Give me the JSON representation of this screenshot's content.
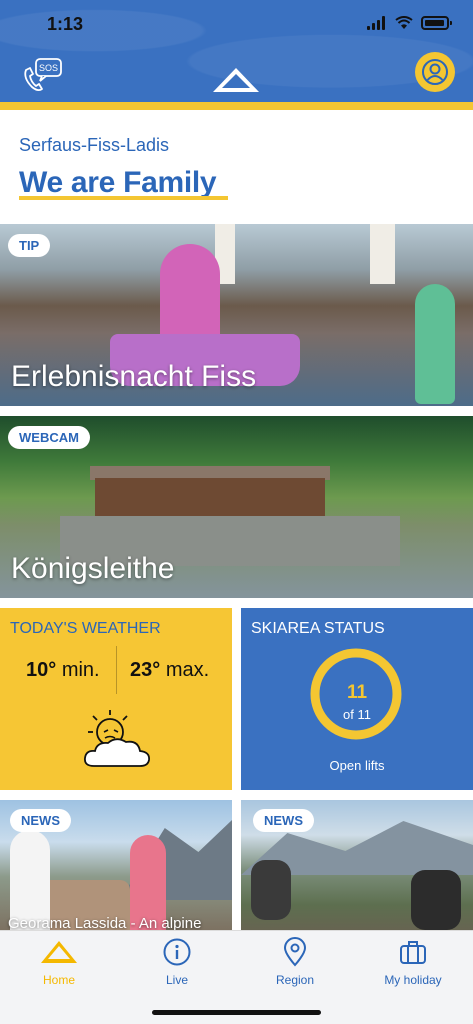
{
  "status_bar": {
    "time": "1:13"
  },
  "header": {
    "sos_label": "SOS"
  },
  "intro": {
    "subtitle": "Serfaus-Fiss-Ladis",
    "title": "We are Family"
  },
  "cards": {
    "tip": {
      "label": "TIP",
      "title": "Erlebnisnacht Fiss"
    },
    "webcam": {
      "label": "WEBCAM",
      "title": "Königsleithe"
    }
  },
  "weather": {
    "title": "TODAY'S WEATHER",
    "min_value": "10°",
    "min_label": "min.",
    "max_value": "23°",
    "max_label": "max.",
    "icon": "sun-behind-cloud-icon"
  },
  "skiarea": {
    "title": "SKIAREA STATUS",
    "open_count": "11",
    "of_text": "of 11",
    "label": "Open lifts",
    "open_fraction": 1.0
  },
  "news": [
    {
      "label": "NEWS",
      "caption": "Georama Lassida - An alpine"
    },
    {
      "label": "NEWS",
      "caption": ""
    }
  ],
  "tabbar": {
    "tabs": [
      {
        "label": "Home",
        "icon": "mountain-icon",
        "active": true
      },
      {
        "label": "Live",
        "icon": "info-icon",
        "active": false
      },
      {
        "label": "Region",
        "icon": "location-pin-icon",
        "active": false
      },
      {
        "label": "My holiday",
        "icon": "suitcase-icon",
        "active": false
      }
    ]
  },
  "colors": {
    "brand_blue": "#3a71c1",
    "accent_yellow": "#f4c632",
    "text_blue": "#2b66b8"
  }
}
